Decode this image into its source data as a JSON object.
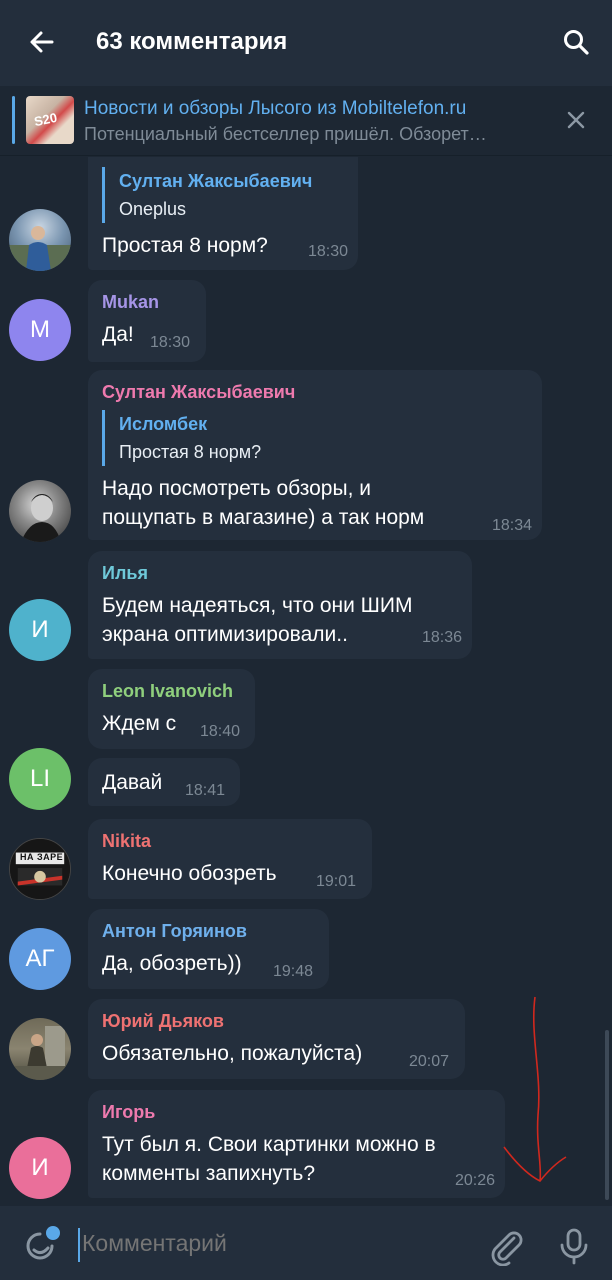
{
  "header": {
    "title": "63 комментария",
    "back_icon": "arrow-left-icon",
    "search_icon": "search-icon"
  },
  "pinned": {
    "thumb_text": "S20",
    "title": "Новости и обзоры Лысого из Mobiltelefon.ru",
    "subtitle": "Потенциальный бестселлер пришёл. Обзорет…"
  },
  "messages": [
    {
      "id": "m1",
      "quote_name": "Султан Жаксыбаевич",
      "quote_text": "Oneplus",
      "text": [
        "Простая 8 норм?"
      ],
      "time": "18:30"
    },
    {
      "id": "m2",
      "sender": "Mukan",
      "sender_color": "#a695e7",
      "text": [
        "Да!"
      ],
      "time": "18:30",
      "avatar_initials": "M",
      "avatar_color": "#8e85ee"
    },
    {
      "id": "m3",
      "sender": "Султан Жаксыбаевич",
      "sender_color": "#ee7aae",
      "quote_name": "Исломбек",
      "quote_text": "Простая 8 норм?",
      "text": [
        "Надо посмотреть обзоры, и",
        "пощупать в магазине) а так норм"
      ],
      "time": "18:34"
    },
    {
      "id": "m4",
      "sender": "Илья",
      "sender_color": "#6fc9d9",
      "text": [
        "Будем надеяться, что они ШИМ",
        "экрана оптимизировали.."
      ],
      "time": "18:36",
      "avatar_initials": "И",
      "avatar_color": "#4fb2cc"
    },
    {
      "id": "m5",
      "sender": "Leon Ivanovich",
      "sender_color": "#8fcf7d",
      "text": [
        "Ждем с"
      ],
      "time": "18:40"
    },
    {
      "id": "m6",
      "text": [
        "Давай"
      ],
      "time": "18:41",
      "avatar_initials": "LI",
      "avatar_color": "#6cc069"
    },
    {
      "id": "m7",
      "sender": "Nikita",
      "sender_color": "#ee7272",
      "text": [
        "Конечно обозреть"
      ],
      "time": "19:01",
      "avatar_text": "НА ЗАРЕ"
    },
    {
      "id": "m8",
      "sender": "Антон Горяинов",
      "sender_color": "#6fb0ec",
      "text": [
        "Да, обозреть))"
      ],
      "time": "19:48",
      "avatar_initials": "АГ",
      "avatar_color": "#5f9ae0"
    },
    {
      "id": "m9",
      "sender": "Юрий Дьяков",
      "sender_color": "#ee7272",
      "text": [
        "Обязательно, пожалуйста)"
      ],
      "time": "20:07"
    },
    {
      "id": "m10",
      "sender": "Игорь",
      "sender_color": "#ee7aae",
      "text": [
        "Тут был я. Свои картинки можно в",
        "комменты запихнуть?"
      ],
      "time": "20:26",
      "avatar_initials": "И",
      "avatar_color": "#ea6f9a"
    }
  ],
  "input": {
    "placeholder": "Комментарий",
    "emoji_icon": "sticker-emoji-icon",
    "attach_icon": "paperclip-icon",
    "mic_icon": "microphone-icon"
  },
  "colors": {
    "background": "#1d2733",
    "header": "#232e3c",
    "bubble": "#242f3d",
    "accent": "#5aa8e8",
    "annotation": "#d0281e"
  }
}
